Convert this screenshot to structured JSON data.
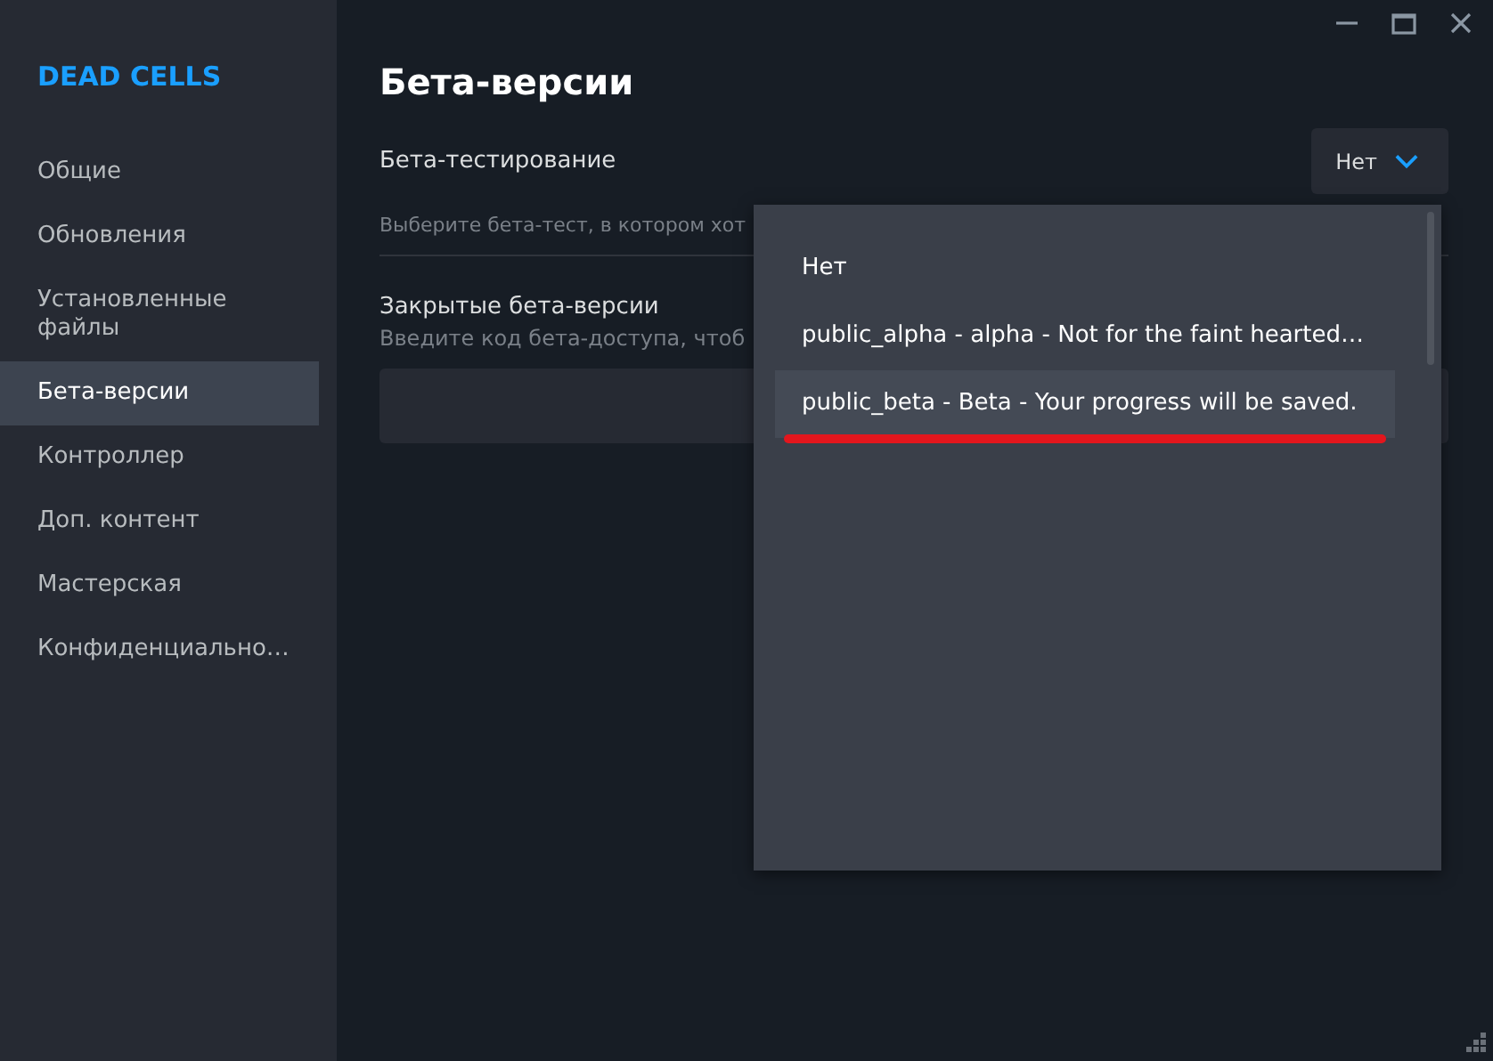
{
  "sidebar": {
    "title": "DEAD CELLS",
    "items": [
      {
        "label": "Общие",
        "selected": false
      },
      {
        "label": "Обновления",
        "selected": false
      },
      {
        "label": "Установленные файлы",
        "selected": false
      },
      {
        "label": "Бета-версии",
        "selected": true
      },
      {
        "label": "Контроллер",
        "selected": false
      },
      {
        "label": "Доп. контент",
        "selected": false
      },
      {
        "label": "Мастерская",
        "selected": false
      },
      {
        "label": "Конфиденциально…",
        "selected": false
      }
    ]
  },
  "page": {
    "title": "Бета-версии",
    "beta_testing": {
      "label": "Бета-тестирование",
      "value": "Нет",
      "description": "Выберите бета-тест, в котором хот"
    },
    "private_betas": {
      "label": "Закрытые бета-версии",
      "description": "Введите код бета-доступа, чтоб"
    }
  },
  "dropdown": {
    "expanded": true,
    "options": [
      {
        "label": "Нет",
        "selected": false
      },
      {
        "label": "public_alpha - alpha - Not for the faint hearted…",
        "selected": false
      },
      {
        "label": "public_beta - Beta - Your progress will be saved.",
        "selected": true,
        "underlined": true
      }
    ]
  }
}
